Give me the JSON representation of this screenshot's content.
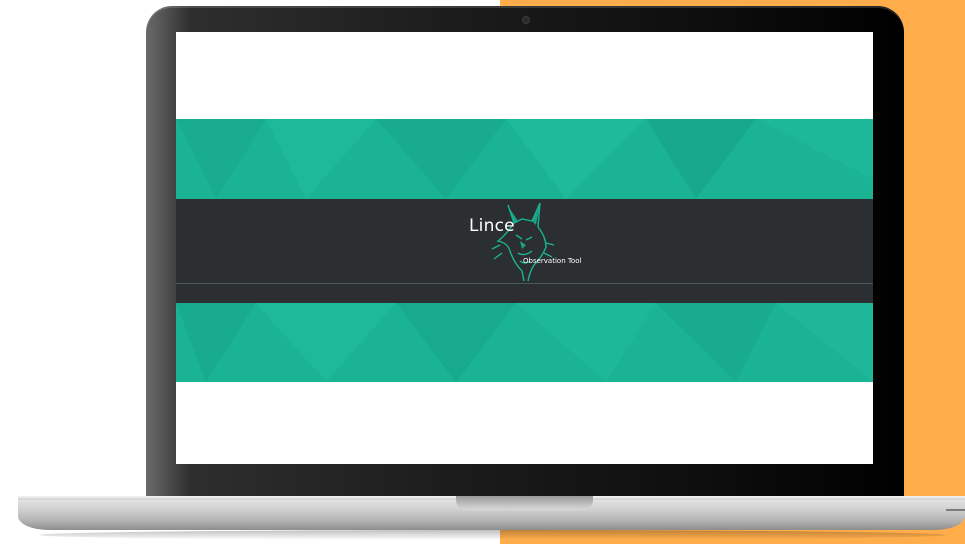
{
  "colors": {
    "accent_background": "#FFAD4B",
    "banner_teal": "#1AB394",
    "banner_dark": "#2B2F31",
    "text_white": "#FFFFFF"
  },
  "screen": {
    "logo": {
      "title": "Lince",
      "subtitle": "Observation Tool",
      "icon": "lynx-head-icon"
    }
  }
}
